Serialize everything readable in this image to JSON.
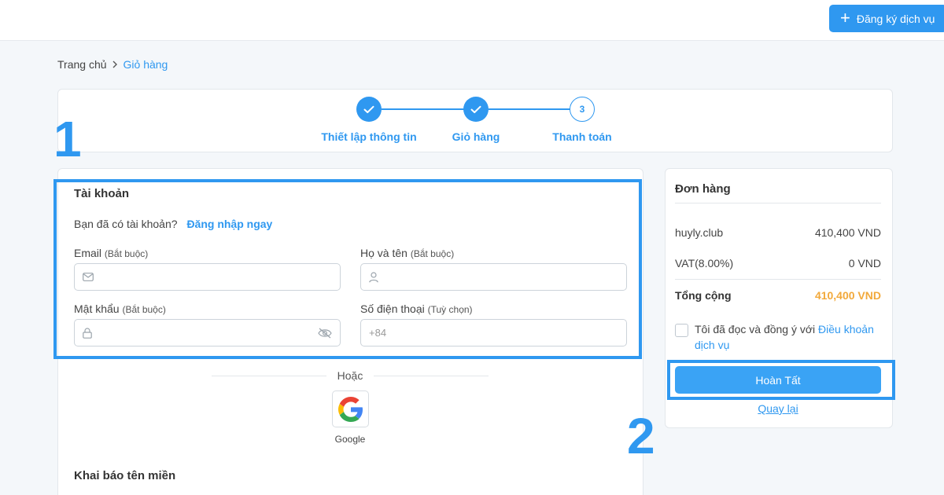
{
  "header": {
    "register_label": "Đăng ký dịch vụ"
  },
  "breadcrumb": {
    "home": "Trang chủ",
    "current": "Giỏ hàng"
  },
  "steps": [
    {
      "label": "Thiết lập thông tin",
      "state": "done"
    },
    {
      "label": "Giỏ hàng",
      "state": "done"
    },
    {
      "label": "Thanh toán",
      "state": "current",
      "number": "3"
    }
  ],
  "annotations": {
    "one": "1",
    "two": "2"
  },
  "account": {
    "title": "Tài khoản",
    "have_account": "Bạn đã có tài khoản?",
    "login_link": "Đăng nhập ngay",
    "email_label": "Email",
    "email_hint": "(Bắt buộc)",
    "name_label": "Họ và tên",
    "name_hint": "(Bắt buộc)",
    "password_label": "Mật khẩu",
    "password_hint": "(Bắt buộc)",
    "phone_label": "Số điện thoại",
    "phone_hint": "(Tuỳ chọn)",
    "phone_placeholder": "+84"
  },
  "social": {
    "or_text": "Hoặc",
    "google_label": "Google"
  },
  "domain_section": {
    "title": "Khai báo tên miền"
  },
  "order": {
    "title": "Đơn hàng",
    "item_name": "huyly.club",
    "item_price": "410,400 VND",
    "vat_label": "VAT(8.00%)",
    "vat_value": "0 VND",
    "total_label": "Tổng cộng",
    "total_value": "410,400 VND",
    "agree_text": "Tôi đã đọc và đồng ý với",
    "terms_link": "Điều khoản dịch vụ",
    "complete_label": "Hoàn Tất",
    "back_label": "Quay lại"
  },
  "colors": {
    "accent": "#2f98f0",
    "total": "#f2a93b"
  }
}
